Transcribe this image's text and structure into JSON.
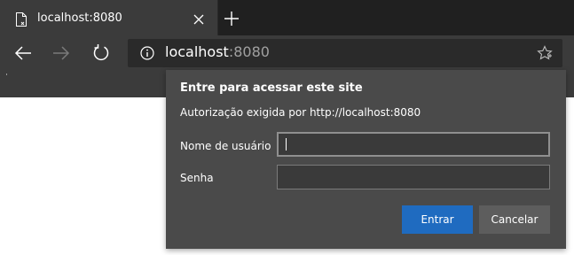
{
  "browser": {
    "tab": {
      "title": "localhost:8080",
      "icon": "document-icon"
    },
    "new_tab_icon": "plus-icon",
    "nav": {
      "back_icon": "arrow-left-icon",
      "forward_icon": "arrow-right-icon",
      "refresh_icon": "refresh-icon"
    },
    "address": {
      "host": "localhost",
      "port": ":8080",
      "info_icon": "info-icon",
      "favorite_icon": "star-icon"
    }
  },
  "auth_dialog": {
    "title": "Entre para acessar este site",
    "description": "Autorização exigida por http://localhost:8080",
    "username_label": "Nome de usuário",
    "username_value": "",
    "password_label": "Senha",
    "password_value": "",
    "submit_label": "Entrar",
    "cancel_label": "Cancelar"
  },
  "colors": {
    "primary_button": "#1f6bc0",
    "dialog_bg": "#4a4a4a"
  }
}
